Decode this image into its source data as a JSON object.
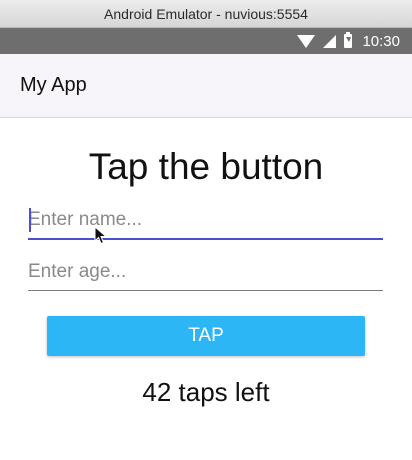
{
  "window": {
    "title": "Android Emulator - nuvious:5554"
  },
  "status_bar": {
    "time": "10:30",
    "icons": [
      "wifi-icon",
      "signal-icon",
      "battery-charging-icon"
    ]
  },
  "app_bar": {
    "title": "My App"
  },
  "main": {
    "heading": "Tap the button",
    "name_input": {
      "value": "",
      "placeholder": "Enter name..."
    },
    "age_input": {
      "value": "",
      "placeholder": "Enter age..."
    },
    "tap_button": {
      "label": "TAP"
    },
    "taps_left": "42 taps left"
  },
  "colors": {
    "accent": "#4a4fd0",
    "button": "#2db6f5",
    "status_bar": "#6e6e6e"
  }
}
